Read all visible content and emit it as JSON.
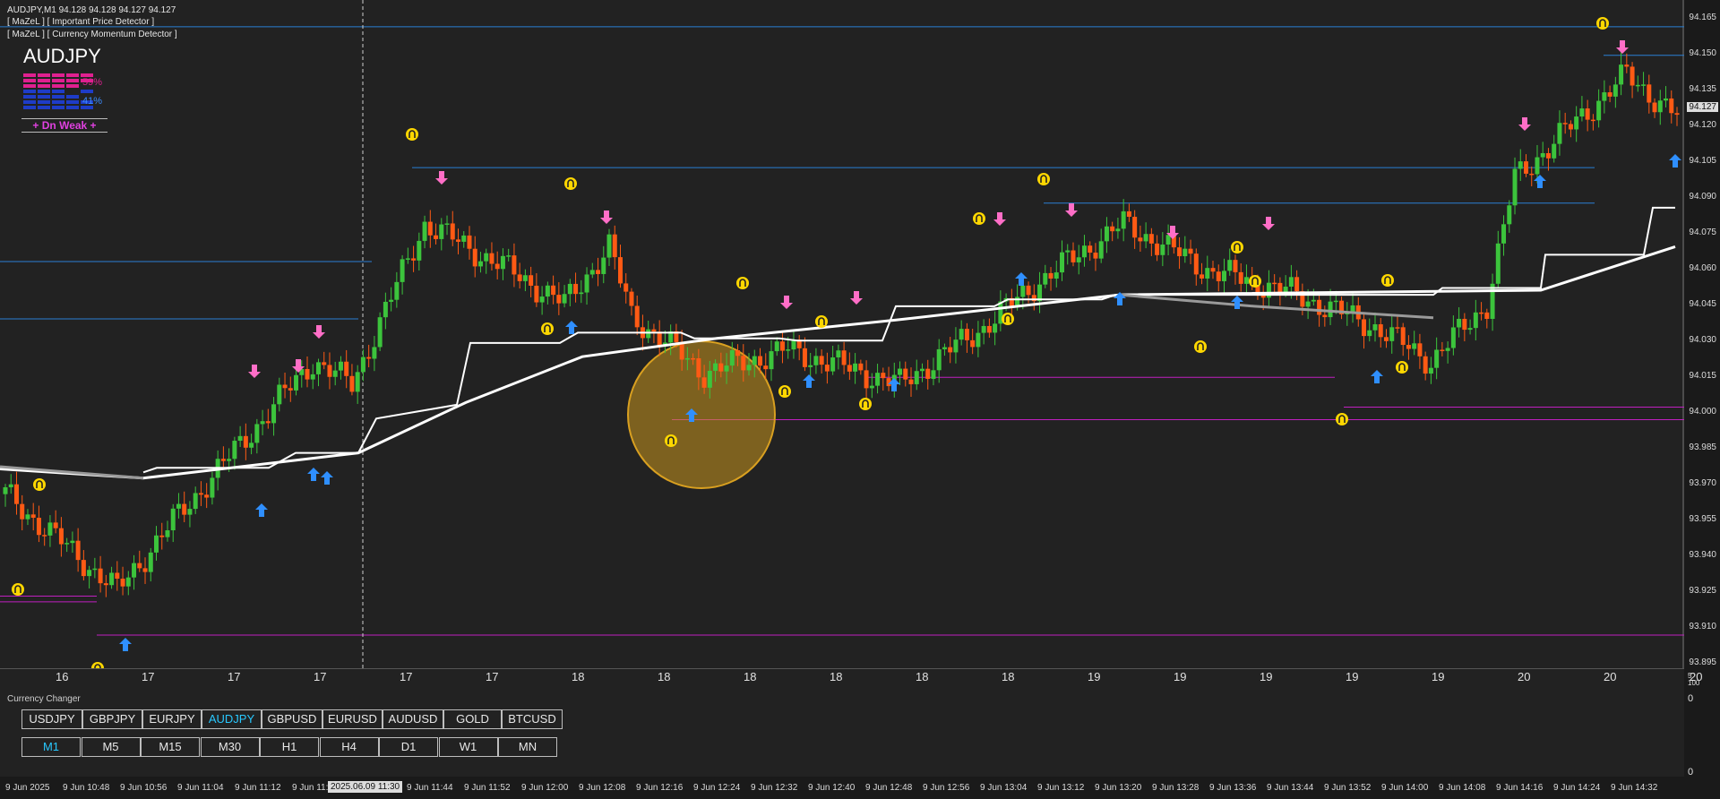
{
  "header": {
    "line1": "AUDJPY,M1  94.128 94.128 94.127 94.127",
    "line2": "[ MaZeL ] [ Important Price Detector ]",
    "line3": "[ MaZeL ] [ Currency Momentum Detector ]"
  },
  "symbol": "AUDJPY",
  "momentum": {
    "up_pct": "59%",
    "down_pct": "41%",
    "status": "+   Dn Weak   +"
  },
  "price_axis": {
    "labels": [
      "94.165",
      "94.150",
      "94.135",
      "94.120",
      "94.105",
      "94.090",
      "94.075",
      "94.060",
      "94.045",
      "94.030",
      "94.015",
      "94.000",
      "93.985",
      "93.970",
      "93.955",
      "93.940",
      "93.925",
      "93.910",
      "93.895"
    ],
    "current": "94.127"
  },
  "bottom_indicator": {
    "values": [
      "16",
      "17",
      "17",
      "17",
      "17",
      "17",
      "18",
      "18",
      "18",
      "18",
      "18",
      "18",
      "19",
      "19",
      "19",
      "19",
      "19",
      "20",
      "20",
      "20"
    ],
    "scale": [
      "5",
      "100"
    ]
  },
  "currency_changer": {
    "title": "Currency Changer",
    "symbols": [
      "USDJPY",
      "GBPJPY",
      "EURJPY",
      "AUDJPY",
      "GBPUSD",
      "EURUSD",
      "AUDUSD",
      "GOLD",
      "BTCUSD"
    ],
    "active_symbol": "AUDJPY",
    "timeframes": [
      "M1",
      "M5",
      "M15",
      "M30",
      "H1",
      "H4",
      "D1",
      "W1",
      "MN"
    ],
    "active_timeframe": "M1",
    "scale_top": "0",
    "scale_bottom": "0"
  },
  "time_axis": {
    "labels": [
      "9 Jun 2025",
      "9 Jun 10:48",
      "9 Jun 10:56",
      "9 Jun 11:04",
      "9 Jun 11:12",
      "9 Jun 11:2",
      "9 Jun 11:36",
      "9 Jun 11:44",
      "9 Jun 11:52",
      "9 Jun 12:00",
      "9 Jun 12:08",
      "9 Jun 12:16",
      "9 Jun 12:24",
      "9 Jun 12:32",
      "9 Jun 12:40",
      "9 Jun 12:48",
      "9 Jun 12:56",
      "9 Jun 13:04",
      "9 Jun 13:12",
      "9 Jun 13:20",
      "9 Jun 13:28",
      "9 Jun 13:36",
      "9 Jun 13:44",
      "9 Jun 13:52",
      "9 Jun 14:00",
      "9 Jun 14:08",
      "9 Jun 14:16",
      "9 Jun 14:24",
      "9 Jun 14:32"
    ],
    "crosshair": "2025.06.09 11:30"
  },
  "colors": {
    "bull": "#3cc43c",
    "bear": "#ff5a14",
    "blue_line": "#2a7fd4",
    "magenta_line": "#c020c0",
    "arrow_up": "#2f8fff",
    "arrow_down": "#ff6ec7",
    "sign": "#ffd700"
  }
}
